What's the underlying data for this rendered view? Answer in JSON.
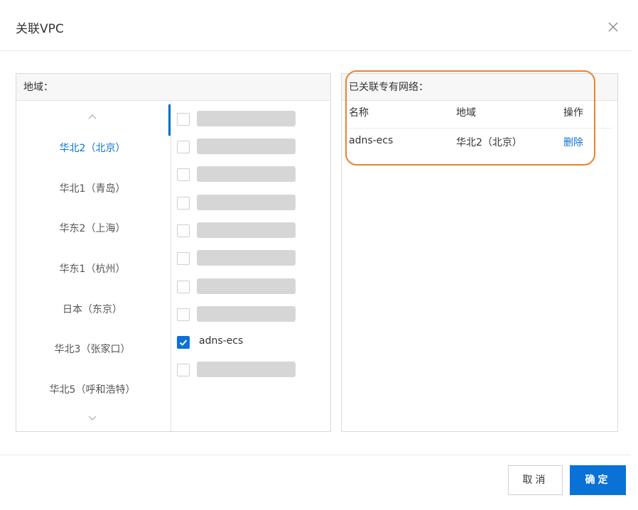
{
  "dialog": {
    "title": "关联VPC",
    "close_icon": "close-icon"
  },
  "left_panel": {
    "header": "地域：",
    "scroll_up_icon": "chevron-up-icon",
    "scroll_down_icon": "chevron-down-icon",
    "regions": [
      {
        "label": "华北2（北京）",
        "active": true
      },
      {
        "label": "华北1（青岛）",
        "active": false
      },
      {
        "label": "华东2（上海）",
        "active": false
      },
      {
        "label": "华东1（杭州）",
        "active": false
      },
      {
        "label": "日本（东京）",
        "active": false
      },
      {
        "label": "华北3（张家口）",
        "active": false
      },
      {
        "label": "华北5（呼和浩特）",
        "active": false
      }
    ],
    "vpcs": [
      {
        "name": "",
        "checked": false,
        "redacted": true
      },
      {
        "name": "",
        "checked": false,
        "redacted": true
      },
      {
        "name": "",
        "checked": false,
        "redacted": true
      },
      {
        "name": "",
        "checked": false,
        "redacted": true
      },
      {
        "name": "",
        "checked": false,
        "redacted": true
      },
      {
        "name": "",
        "checked": false,
        "redacted": true
      },
      {
        "name": "",
        "checked": false,
        "redacted": true
      },
      {
        "name": "",
        "checked": false,
        "redacted": true
      },
      {
        "name": "adns-ecs",
        "checked": true,
        "redacted": false
      },
      {
        "name": "",
        "checked": false,
        "redacted": true
      }
    ]
  },
  "right_panel": {
    "header": "已关联专有网络：",
    "columns": [
      "名称",
      "地域",
      "操作"
    ],
    "rows": [
      {
        "name": "adns-ecs",
        "region": "华北2（北京）",
        "action": "删除"
      }
    ]
  },
  "footer": {
    "cancel_label": "取消",
    "ok_label": "确定"
  },
  "colors": {
    "accent": "#0a72d6",
    "highlight": "#e8832f",
    "placeholder_bar": "#d6d6d6"
  }
}
